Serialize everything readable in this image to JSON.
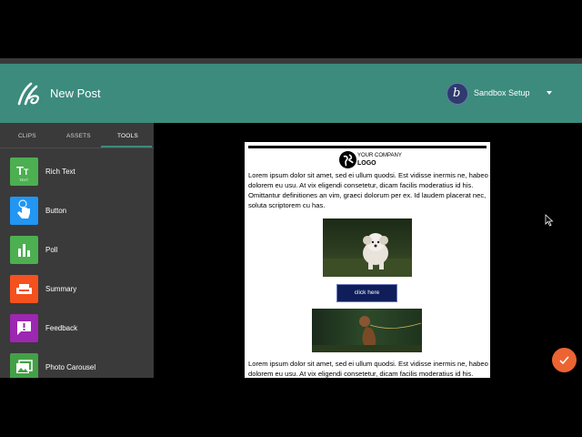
{
  "header": {
    "title": "New Post",
    "account_name": "Sandbox Setup"
  },
  "sidebar": {
    "tabs": [
      {
        "label": "CLIPS"
      },
      {
        "label": "ASSETS"
      },
      {
        "label": "TOOLS"
      }
    ],
    "active_tab": "TOOLS",
    "tools": [
      {
        "label": "Rich Text",
        "icon": "rich-text-icon",
        "color": "#4caf50",
        "icon_text": "TEXT"
      },
      {
        "label": "Button",
        "icon": "hand-pointer-icon",
        "color": "#2196f3"
      },
      {
        "label": "Poll",
        "icon": "bar-chart-icon",
        "color": "#4caf50"
      },
      {
        "label": "Summary",
        "icon": "sofa-icon",
        "color": "#f4511e"
      },
      {
        "label": "Feedback",
        "icon": "feedback-icon",
        "color": "#9c27b0"
      },
      {
        "label": "Photo Carousel",
        "icon": "photo-carousel-icon",
        "color": "#43a047"
      }
    ]
  },
  "email": {
    "company_line": "YOUR COMPANY",
    "logo_text": "LOGO",
    "paragraph": "Lorem ipsum dolor sit amet, sed ei ullum quodsi. Est vidisse inermis ne, habeo dolorem eu usu. At vix eligendi consetetur, dicam facilis moderatius id his. Omittantur definitiones an vim, graeci dolorum per ex. Id laudem placerat nec, soluta scriptorem cu has.",
    "paragraph2": "Lorem ipsum dolor sit amet, sed ei ullum quodsi. Est vidisse inermis ne, habeo dolorem eu usu. At vix eligendi consetetur, dicam facilis moderatius id his. Omittantur definitiones an vim, graeci dolorum per",
    "button_label": "click here"
  },
  "colors": {
    "header": "#3c8b7d",
    "sidebar": "#3a3a3a",
    "fab": "#ec6432",
    "email_button": "#0f1e5a"
  }
}
